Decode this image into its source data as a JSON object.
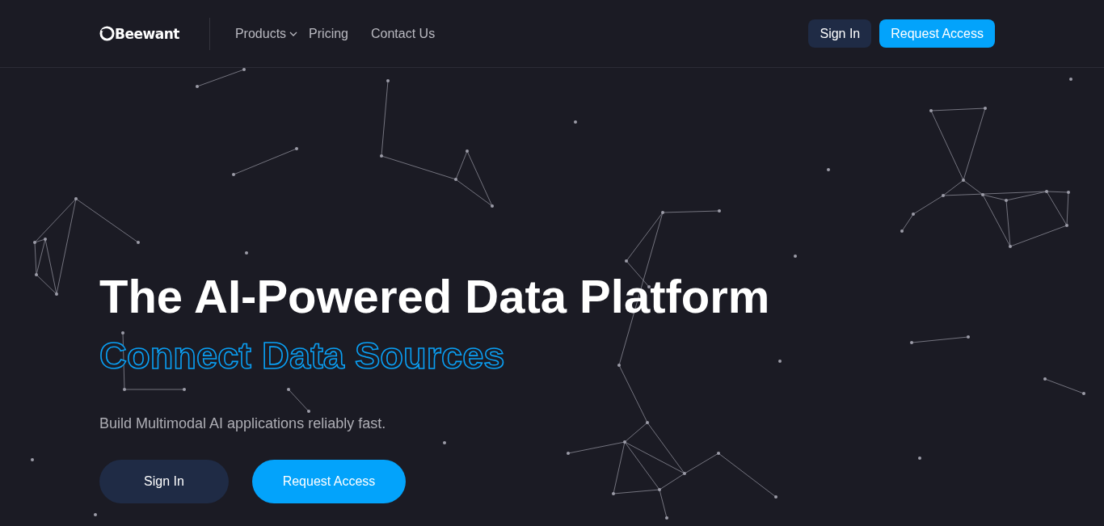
{
  "header": {
    "logo": "Beewant",
    "nav": [
      {
        "label": "Products",
        "kind": "dropdown"
      },
      {
        "label": "Pricing",
        "kind": "link"
      },
      {
        "label": "Contact Us",
        "kind": "link"
      }
    ],
    "buttons": [
      {
        "label": "Sign In",
        "kind": "secondary"
      },
      {
        "label": "Request Access",
        "kind": "primary"
      }
    ]
  },
  "hero": {
    "title": "The AI-Powered Data Platform",
    "highlight": "Connect Data Sources",
    "subtitle": "Build Multimodal AI applications reliably fast.",
    "buttons": [
      {
        "label": "Sign In",
        "kind": "secondary"
      },
      {
        "label": "Request Access",
        "kind": "primary"
      }
    ]
  }
}
